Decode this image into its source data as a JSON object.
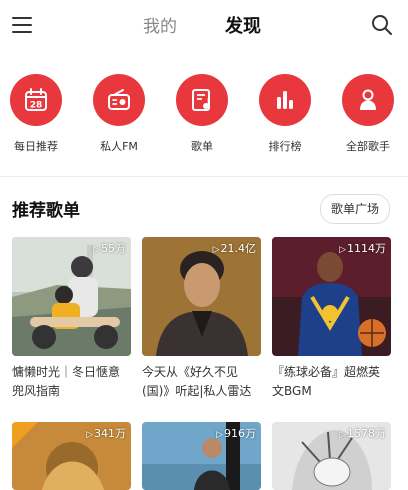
{
  "header": {
    "tab_mine": "我的",
    "tab_discover": "发现"
  },
  "quick_actions": [
    {
      "label": "每日推荐",
      "icon": "calendar-icon",
      "day": "28"
    },
    {
      "label": "私人FM",
      "icon": "radio-icon"
    },
    {
      "label": "歌单",
      "icon": "playlist-icon"
    },
    {
      "label": "排行榜",
      "icon": "chart-bars-icon"
    },
    {
      "label": "全部歌手",
      "icon": "singer-icon"
    }
  ],
  "section": {
    "title": "推荐歌单",
    "more_label": "歌单广场"
  },
  "playlists": [
    {
      "count": "55万",
      "title": "慵懒时光｜冬日惬意兜风指南"
    },
    {
      "count": "21.4亿",
      "title": "今天从《好久不见(国)》听起|私人雷达"
    },
    {
      "count": "1114万",
      "title": "『练球必备』超燃英文BGM"
    },
    {
      "count": "341万",
      "title": ""
    },
    {
      "count": "916万",
      "title": ""
    },
    {
      "count": "1578万",
      "title": ""
    }
  ],
  "colors": {
    "accent": "#e8383d"
  }
}
